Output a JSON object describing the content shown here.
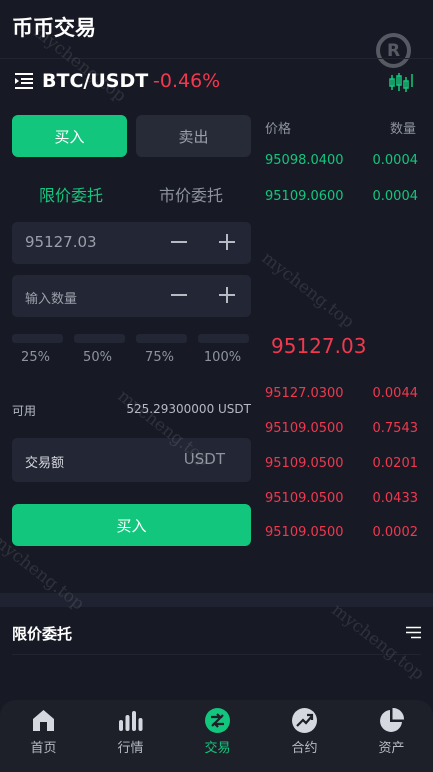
{
  "page": {
    "title": "币币交易"
  },
  "pair": {
    "name": "BTC/USDT",
    "change": "-0.46%"
  },
  "trade": {
    "buy_tab": "买入",
    "sell_tab": "卖出",
    "limit_type": "限价委托",
    "market_type": "市价委托",
    "price_value": "95127.03",
    "qty_placeholder": "输入数量",
    "percents": [
      "25%",
      "50%",
      "75%",
      "100%"
    ],
    "available_label": "可用",
    "available_value": "525.29300000 USDT",
    "amount_label": "交易额",
    "amount_unit": "USDT",
    "buy_button": "买入"
  },
  "orderbook": {
    "price_header": "价格",
    "qty_header": "数量",
    "bids": [
      {
        "price": "95098.0400",
        "qty": "0.0004"
      },
      {
        "price": "95109.0600",
        "qty": "0.0004"
      }
    ],
    "last_price": "95127.03",
    "asks": [
      {
        "price": "95127.0300",
        "qty": "0.0044"
      },
      {
        "price": "95109.0500",
        "qty": "0.7543"
      },
      {
        "price": "95109.0500",
        "qty": "0.0201"
      },
      {
        "price": "95109.0500",
        "qty": "0.0433"
      },
      {
        "price": "95109.0500",
        "qty": "0.0002"
      }
    ]
  },
  "orders": {
    "title": "限价委托"
  },
  "tabbar": {
    "items": [
      {
        "label": "首页",
        "icon": "home-icon"
      },
      {
        "label": "行情",
        "icon": "market-icon"
      },
      {
        "label": "交易",
        "icon": "trade-icon"
      },
      {
        "label": "合约",
        "icon": "contract-icon"
      },
      {
        "label": "资产",
        "icon": "assets-icon"
      }
    ]
  },
  "watermark": {
    "text": "mycheng.top"
  },
  "colors": {
    "accent": "#13c67d",
    "down": "#f0384f",
    "background": "#171a24"
  }
}
